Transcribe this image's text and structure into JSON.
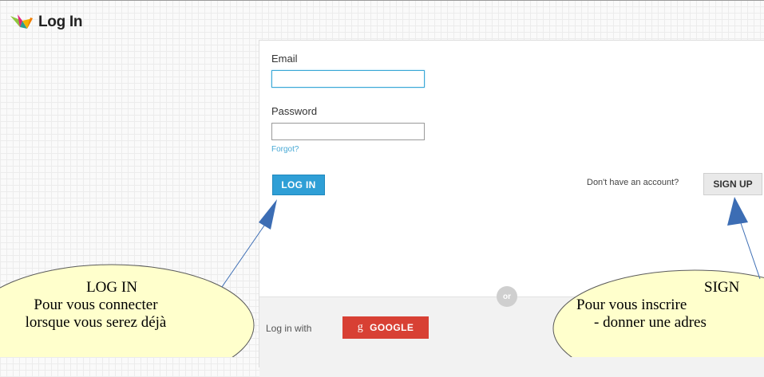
{
  "header": {
    "title": "Log In",
    "logo_icon": "crane-logo-icon"
  },
  "form": {
    "email_label": "Email",
    "email_value": "",
    "password_label": "Password",
    "password_value": "",
    "forgot_label": "Forgot?",
    "login_button": "LOG IN",
    "no_account_text": "Don't have an account?",
    "signup_button": "SIGN UP",
    "or_label": "or",
    "login_with_label": "Log in with",
    "google_icon": "g",
    "google_button": "GOOGLE"
  },
  "callouts": {
    "login": {
      "line1": "LOG IN",
      "line2": "Pour vous connecter",
      "line3": "lorsque vous serez déjà"
    },
    "signup": {
      "line1": "SIGN",
      "line2": "Pour vous inscrire",
      "line3": "- donner une adres"
    }
  },
  "colors": {
    "accent": "#2f9fd6",
    "google": "#d84034",
    "bubble_fill": "#ffffcc",
    "arrow": "#3c6db4"
  }
}
